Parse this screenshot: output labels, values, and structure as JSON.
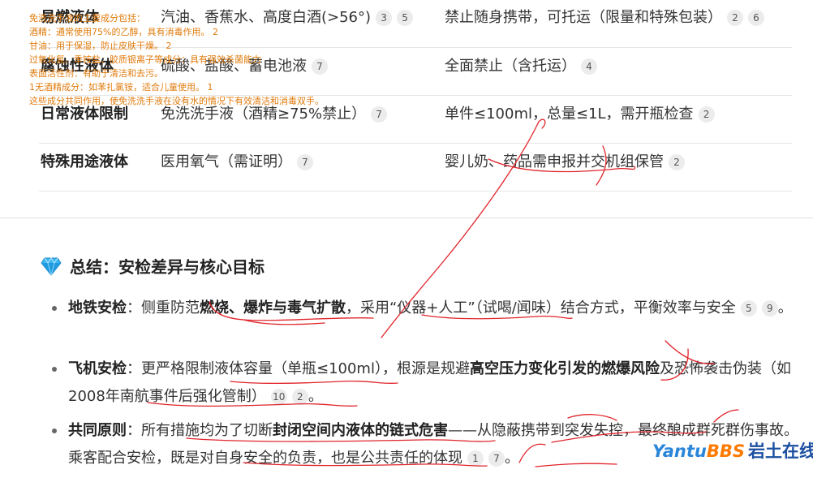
{
  "table": {
    "rows": [
      {
        "category": "易燃液体",
        "examples": "汽油、香蕉水、高度白酒(>56°)",
        "examples_cites": [
          "3",
          "5"
        ],
        "rule": "禁止随身携带，可托运（限量和特殊包装）",
        "rule_cites": [
          "2",
          "6"
        ]
      },
      {
        "category": "腐蚀性液体",
        "examples": "硫酸、盐酸、蓄电池液",
        "examples_cites": [
          "7"
        ],
        "rule": "全面禁止（含托运）",
        "rule_cites": [
          "4"
        ]
      },
      {
        "category": "日常液体限制",
        "examples": "免洗洗手液（酒精≥75%禁止）",
        "examples_cites": [
          "7"
        ],
        "rule": "单件≤100ml，总量≤1L，需开瓶检查",
        "rule_cites": [
          "2"
        ]
      },
      {
        "category": "特殊用途液体",
        "examples": "医用氧气（需证明）",
        "examples_cites": [
          "7"
        ],
        "rule": "婴儿奶、药品需申报并交机组保管",
        "rule_cites": [
          "2"
        ]
      }
    ]
  },
  "overlay_notes": [
    "免洗洗手液的主要成分包括：",
    "酒精：通常使用75%的乙醇，具有消毒作用。 2",
    "甘油：用于保湿，防止皮肤干燥。 2",
    "过氧化氢、季铵盐、胶质银离子等成分：具有强效杀菌能力",
    "表面活性剂：有助于清洁和去污。",
    "1无酒精成分：如苯扎氯铵，适合儿童使用。 1",
    "这些成分共同作用，使免洗洗手液在没有水的情况下有效清洁和消毒双手。"
  ],
  "summary": {
    "icon": "gem-icon",
    "title": "总结：安检差异与核心目标",
    "bullets": [
      {
        "label": "地铁安检",
        "sep": "：",
        "t1": "侧重防范",
        "b1": "燃烧、爆炸与毒气扩散",
        "t2": "，采用“仪器+人工”（试喝/闻味）结合方式，平衡效率与安全",
        "cites": [
          "5",
          "9"
        ],
        "end": "。"
      },
      {
        "label": "飞机安检",
        "sep": "：",
        "t1": "更严格限制液体容量（单瓶≤100ml），根源是规避",
        "b1": "高空压力变化引发的燃爆风险",
        "t2": "及恐怖袭击伪装（如2008年南航事件后强化管制）",
        "cites": [
          "10",
          "2"
        ],
        "end": "。"
      },
      {
        "label": "共同原则",
        "sep": "：",
        "t1": "所有措施均为了切断",
        "b1": "封闭空间内液体的链式危害",
        "t2": "——从隐蔽携带到突发失控，最终酿成群死群伤事故。乘客配合安检，既是对自身安全的负责，也是公共责任的体现",
        "cites": [
          "1",
          "7"
        ],
        "end": "。"
      }
    ]
  },
  "watermark": {
    "brand_a": "Yantu",
    "brand_b": "BBS",
    "brand_cn": "岩土在线"
  },
  "colors": {
    "annotation_ink": "#e0242a",
    "overlay_text": "#e07b0c",
    "brand_blue": "#2a86d8",
    "brand_orange": "#ff7a00"
  }
}
